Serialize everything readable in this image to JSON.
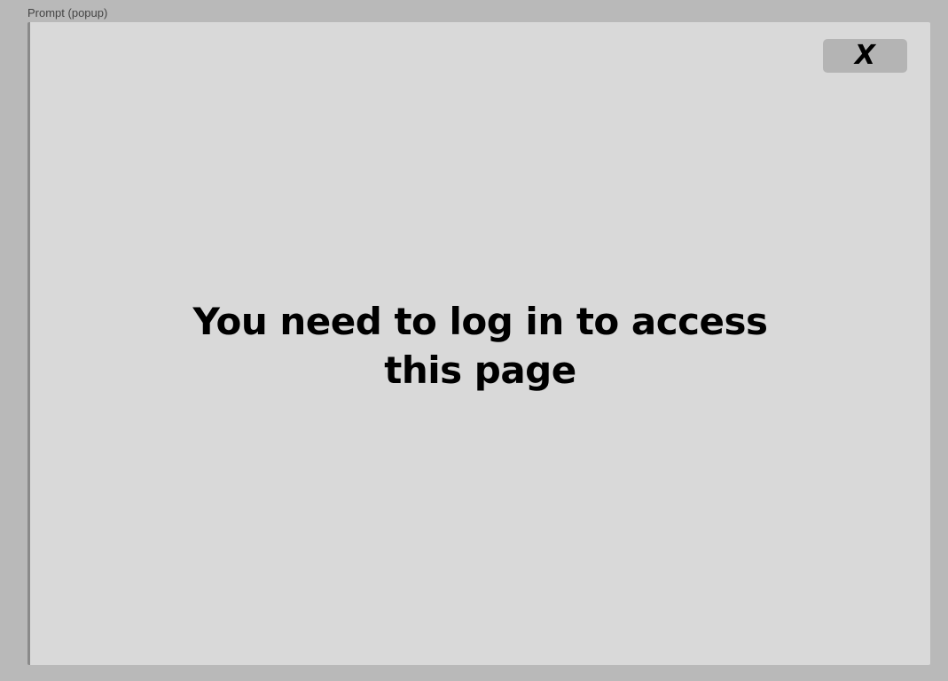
{
  "frame": {
    "label": "Prompt (popup)"
  },
  "popup": {
    "close_label": "X",
    "message": "You need to log in to access this page"
  }
}
